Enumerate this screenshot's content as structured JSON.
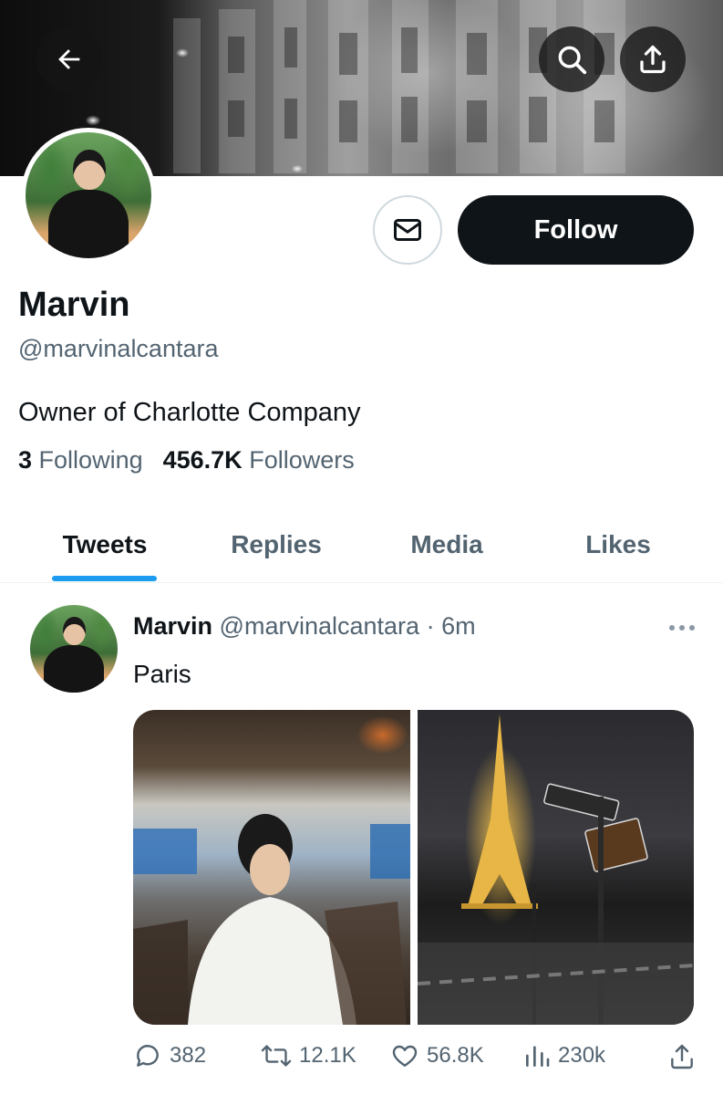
{
  "header": {
    "back_icon": "arrow-left-icon",
    "search_icon": "search-icon",
    "share_icon": "share-icon"
  },
  "profile": {
    "name": "Marvin",
    "handle": "@marvinalcantara",
    "bio": "Owner of Charlotte Company",
    "following_count": "3",
    "following_label": "Following",
    "followers_count": "456.7K",
    "followers_label": "Followers",
    "follow_label": "Follow",
    "message_icon": "mail-icon"
  },
  "tabs": [
    {
      "label": "Tweets",
      "active": true
    },
    {
      "label": "Replies",
      "active": false
    },
    {
      "label": "Media",
      "active": false
    },
    {
      "label": "Likes",
      "active": false
    }
  ],
  "tweet": {
    "author": "Marvin",
    "handle": "@marvinalcantara",
    "separator": "·",
    "time": "6m",
    "text": "Paris",
    "replies": "382",
    "retweets": "12.1K",
    "likes": "56.8K",
    "views": "230k"
  },
  "colors": {
    "accent": "#1d9bf0",
    "follow_button_bg": "#0f1419",
    "secondary_text": "#536471"
  }
}
